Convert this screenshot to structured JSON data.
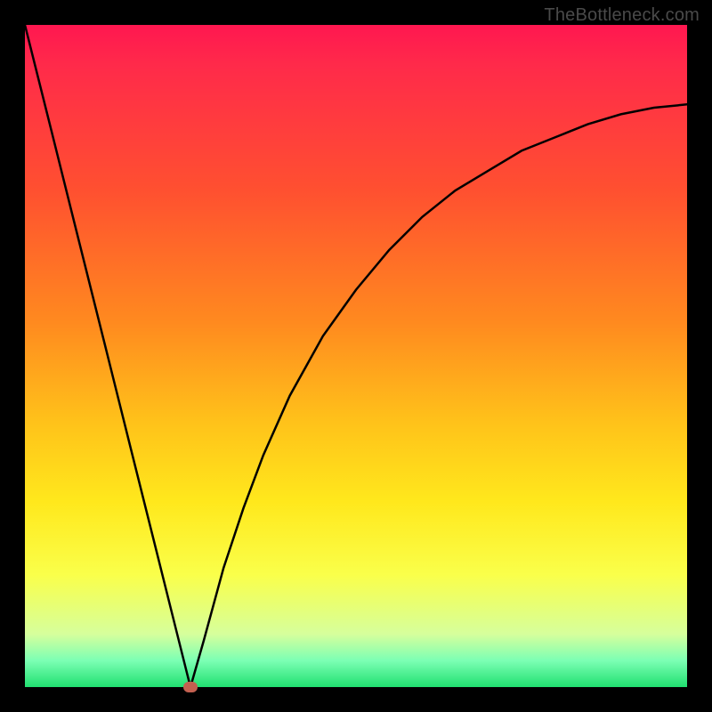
{
  "watermark": {
    "text": "TheBottleneck.com"
  },
  "chart_data": {
    "type": "line",
    "title": "",
    "xlabel": "",
    "ylabel": "",
    "xlim": [
      0,
      100
    ],
    "ylim": [
      0,
      100
    ],
    "grid": false,
    "series": [
      {
        "name": "bottleneck-curve",
        "x": [
          0,
          4,
          8,
          12,
          16,
          20,
          23,
          25,
          27,
          30,
          33,
          36,
          40,
          45,
          50,
          55,
          60,
          65,
          70,
          75,
          80,
          85,
          90,
          95,
          100
        ],
        "y": [
          100,
          84,
          68,
          52,
          36,
          20,
          8,
          0,
          7,
          18,
          27,
          35,
          44,
          53,
          60,
          66,
          71,
          75,
          78,
          81,
          83,
          85,
          86.5,
          87.5,
          88
        ]
      }
    ],
    "annotations": [
      {
        "name": "min-marker",
        "x": 25,
        "y": 0
      }
    ],
    "background_gradient": {
      "direction": "vertical",
      "stops": [
        {
          "pos": 0.0,
          "color": "#ff1750"
        },
        {
          "pos": 0.25,
          "color": "#ff5030"
        },
        {
          "pos": 0.6,
          "color": "#ffc21a"
        },
        {
          "pos": 0.83,
          "color": "#faff4a"
        },
        {
          "pos": 0.96,
          "color": "#7cffb4"
        },
        {
          "pos": 1.0,
          "color": "#20e070"
        }
      ]
    }
  }
}
